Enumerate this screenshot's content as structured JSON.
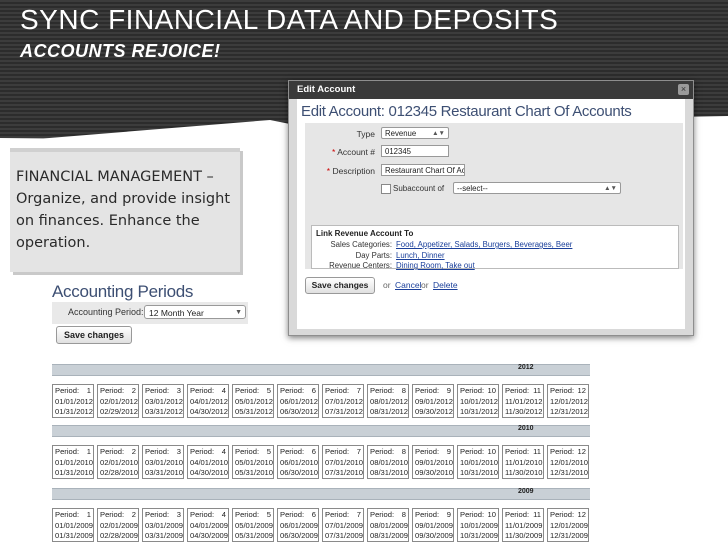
{
  "slide": {
    "title": "SYNC FINANCIAL DATA AND DEPOSITS",
    "subtitle": "ACCOUNTS REJOICE!"
  },
  "callout": {
    "text": "FINANCIAL MANAGEMENT – Organize, and provide insight on finances. Enhance the operation."
  },
  "accounting_periods": {
    "title": "Accounting Periods",
    "field_label": "Accounting Period:",
    "selected_value": "12 Month Year",
    "save_label": "Save changes",
    "years": [
      {
        "year": "2012",
        "periods": [
          {
            "label": "Period:",
            "num": "1",
            "start": "01/01/2012",
            "end": "01/31/2012"
          },
          {
            "label": "Period:",
            "num": "2",
            "start": "02/01/2012",
            "end": "02/29/2012"
          },
          {
            "label": "Period:",
            "num": "3",
            "start": "03/01/2012",
            "end": "03/31/2012"
          },
          {
            "label": "Period:",
            "num": "4",
            "start": "04/01/2012",
            "end": "04/30/2012"
          },
          {
            "label": "Period:",
            "num": "5",
            "start": "05/01/2012",
            "end": "05/31/2012"
          },
          {
            "label": "Period:",
            "num": "6",
            "start": "06/01/2012",
            "end": "06/30/2012"
          },
          {
            "label": "Period:",
            "num": "7",
            "start": "07/01/2012",
            "end": "07/31/2012"
          },
          {
            "label": "Period:",
            "num": "8",
            "start": "08/01/2012",
            "end": "08/31/2012"
          },
          {
            "label": "Period:",
            "num": "9",
            "start": "09/01/2012",
            "end": "09/30/2012"
          },
          {
            "label": "Period:",
            "num": "10",
            "start": "10/01/2012",
            "end": "10/31/2012"
          },
          {
            "label": "Period:",
            "num": "11",
            "start": "11/01/2012",
            "end": "11/30/2012"
          },
          {
            "label": "Period:",
            "num": "12",
            "start": "12/01/2012",
            "end": "12/31/2012"
          }
        ]
      },
      {
        "year": "2010",
        "periods": [
          {
            "label": "Period:",
            "num": "1",
            "start": "01/01/2010",
            "end": "01/31/2010"
          },
          {
            "label": "Period:",
            "num": "2",
            "start": "02/01/2010",
            "end": "02/28/2010"
          },
          {
            "label": "Period:",
            "num": "3",
            "start": "03/01/2010",
            "end": "03/31/2010"
          },
          {
            "label": "Period:",
            "num": "4",
            "start": "04/01/2010",
            "end": "04/30/2010"
          },
          {
            "label": "Period:",
            "num": "5",
            "start": "05/01/2010",
            "end": "05/31/2010"
          },
          {
            "label": "Period:",
            "num": "6",
            "start": "06/01/2010",
            "end": "06/30/2010"
          },
          {
            "label": "Period:",
            "num": "7",
            "start": "07/01/2010",
            "end": "07/31/2010"
          },
          {
            "label": "Period:",
            "num": "8",
            "start": "08/01/2010",
            "end": "08/31/2010"
          },
          {
            "label": "Period:",
            "num": "9",
            "start": "09/01/2010",
            "end": "09/30/2010"
          },
          {
            "label": "Period:",
            "num": "10",
            "start": "10/01/2010",
            "end": "10/31/2010"
          },
          {
            "label": "Period:",
            "num": "11",
            "start": "11/01/2010",
            "end": "11/30/2010"
          },
          {
            "label": "Period:",
            "num": "12",
            "start": "12/01/2010",
            "end": "12/31/2010"
          }
        ]
      },
      {
        "year": "2009",
        "periods": [
          {
            "label": "Period:",
            "num": "1",
            "start": "01/01/2009",
            "end": "01/31/2009"
          },
          {
            "label": "Period:",
            "num": "2",
            "start": "02/01/2009",
            "end": "02/28/2009"
          },
          {
            "label": "Period:",
            "num": "3",
            "start": "03/01/2009",
            "end": "03/31/2009"
          },
          {
            "label": "Period:",
            "num": "4",
            "start": "04/01/2009",
            "end": "04/30/2009"
          },
          {
            "label": "Period:",
            "num": "5",
            "start": "05/01/2009",
            "end": "05/31/2009"
          },
          {
            "label": "Period:",
            "num": "6",
            "start": "06/01/2009",
            "end": "06/30/2009"
          },
          {
            "label": "Period:",
            "num": "7",
            "start": "07/01/2009",
            "end": "07/31/2009"
          },
          {
            "label": "Period:",
            "num": "8",
            "start": "08/01/2009",
            "end": "08/31/2009"
          },
          {
            "label": "Period:",
            "num": "9",
            "start": "09/01/2009",
            "end": "09/30/2009"
          },
          {
            "label": "Period:",
            "num": "10",
            "start": "10/01/2009",
            "end": "10/31/2009"
          },
          {
            "label": "Period:",
            "num": "11",
            "start": "11/01/2009",
            "end": "11/30/2009"
          },
          {
            "label": "Period:",
            "num": "12",
            "start": "12/01/2009",
            "end": "12/31/2009"
          }
        ]
      }
    ]
  },
  "edit_account": {
    "window_title": "Edit Account",
    "heading": "Edit Account: 012345 Restaurant Chart Of Accounts",
    "type_label": "Type",
    "type_value": "Revenue",
    "account_label": "Account #",
    "account_value": "012345",
    "description_label": "Description",
    "description_value": "Restaurant Chart Of Acco",
    "required_mark": "*",
    "subaccount_label": "Subaccount of",
    "subaccount_value": "--select--",
    "link_box": {
      "title": "Link Revenue Account To",
      "sales_label": "Sales Categories:",
      "sales_value": "Food, Appetizer, Salads, Burgers, Beverages, Beer",
      "dayparts_label": "Day Parts:",
      "dayparts_value": "Lunch, Dinner",
      "centers_label": "Revenue Centers:",
      "centers_value": "Dining Room, Take out"
    },
    "save_label": "Save changes",
    "or_1": "or",
    "cancel_label": "Cancel",
    "or_2": "or",
    "delete_label": "Delete"
  },
  "icons": {
    "close": "close-icon",
    "dropdown": "chevron-down-icon"
  },
  "colors": {
    "header_band": "#333333",
    "heading_blue": "#3d4f73",
    "link_blue": "#1a3f9a",
    "year_bar": "#c9d0d6"
  }
}
